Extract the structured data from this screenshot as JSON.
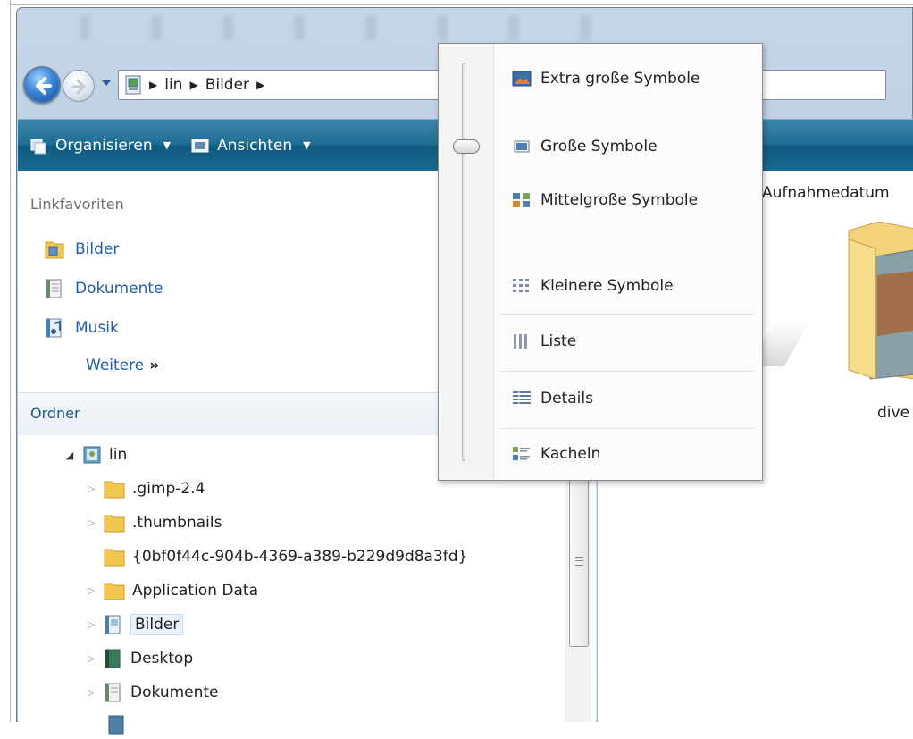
{
  "navigation": {
    "back_tooltip": "",
    "breadcrumb": [
      "lin",
      "Bilder"
    ]
  },
  "command_bar": {
    "organize_label": "Organisieren",
    "views_label": "Ansichten"
  },
  "nav_pane": {
    "favorites_heading": "Linkfavoriten",
    "favorites": [
      {
        "label": "Bilder",
        "icon": "pictures-folder-icon"
      },
      {
        "label": "Dokumente",
        "icon": "documents-icon"
      },
      {
        "label": "Musik",
        "icon": "music-icon"
      }
    ],
    "more_label": "Weitere",
    "more_glyph": "»",
    "folders_heading": "Ordner",
    "tree": [
      {
        "label": "lin",
        "level": 0,
        "expander": "open",
        "icon": "user-folder-icon"
      },
      {
        "label": ".gimp-2.4",
        "level": 1,
        "expander": "closed",
        "icon": "folder-icon"
      },
      {
        "label": ".thumbnails",
        "level": 1,
        "expander": "closed",
        "icon": "folder-icon"
      },
      {
        "label": "{0bf0f44c-904b-4369-a389-b229d9d8a3fd}",
        "level": 1,
        "expander": "none",
        "icon": "folder-icon"
      },
      {
        "label": "Application Data",
        "level": 1,
        "expander": "closed",
        "icon": "folder-icon"
      },
      {
        "label": "Bilder",
        "level": 1,
        "expander": "closed",
        "icon": "pictures-folder-icon",
        "selected": true
      },
      {
        "label": "Desktop",
        "level": 1,
        "expander": "closed",
        "icon": "desktop-folder-icon"
      },
      {
        "label": "Dokumente",
        "level": 1,
        "expander": "closed",
        "icon": "documents-icon"
      }
    ]
  },
  "content": {
    "column_header": "Aufnahmedatum",
    "folder_label": "dive"
  },
  "view_menu": {
    "slider_level": "Große Symbole",
    "items": [
      {
        "label": "Extra große Symbole",
        "icon": "extra-large-icons-icon"
      },
      {
        "label": "Große Symbole",
        "icon": "large-icons-icon"
      },
      {
        "label": "Mittelgroße Symbole",
        "icon": "medium-icons-icon"
      },
      {
        "label": "Kleinere Symbole",
        "icon": "small-icons-icon"
      },
      {
        "label": "Liste",
        "icon": "list-view-icon"
      },
      {
        "label": "Details",
        "icon": "details-view-icon"
      },
      {
        "label": "Kacheln",
        "icon": "tiles-view-icon"
      }
    ]
  },
  "colors": {
    "command_bar": "#1f6d94",
    "link_blue": "#1f5fa9",
    "folder_yellow": "#f0c850"
  }
}
